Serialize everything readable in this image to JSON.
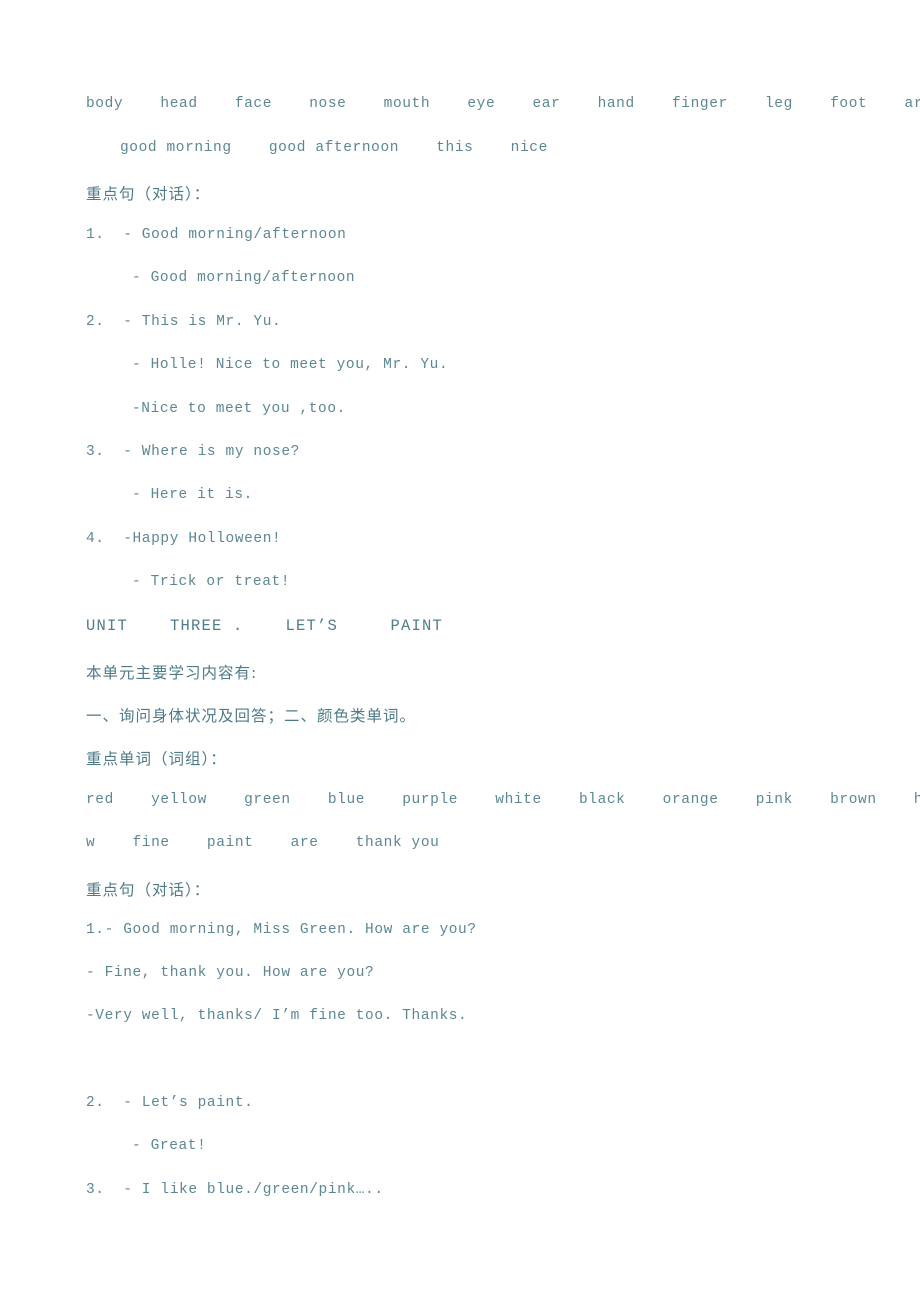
{
  "document": {
    "language": "zh-CN + en",
    "text_color": "#55808c",
    "background_color": "#ffffff",
    "unit_two_tail": {
      "vocabulary_line_1": "body    head    face    nose    mouth    eye    ear    hand    finger    leg    foot    arm",
      "vocabulary_line_2": "good morning    good afternoon    this    nice",
      "vocabulary_words_1": [
        "body",
        "head",
        "face",
        "nose",
        "mouth",
        "eye",
        "ear",
        "hand",
        "finger",
        "leg",
        "foot",
        "arm"
      ],
      "vocabulary_words_2": [
        "good morning",
        "good afternoon",
        "this",
        "nice"
      ],
      "key_sentences_heading": "重点句（对话）：",
      "dialogues": [
        {
          "number": "1.",
          "lines": [
            "1.  - Good morning/afternoon",
            "- Good morning/afternoon"
          ]
        },
        {
          "number": "2.",
          "lines": [
            "2.  - This is Mr. Yu.",
            "- Holle! Nice to meet you, Mr. Yu.",
            "-Nice to meet you ,too."
          ]
        },
        {
          "number": "3.",
          "lines": [
            "3.  - Where is my nose?",
            "- Here it is."
          ]
        },
        {
          "number": "4.",
          "lines": [
            "4.  -Happy Holloween!",
            "- Trick or treat!"
          ]
        }
      ]
    },
    "unit_three": {
      "title": "UNIT    THREE .    LET’S     PAINT",
      "overview_heading": "本单元主要学习内容有:",
      "overview_content": "一、询问身体状况及回答；二、颜色类单词。",
      "vocabulary_heading": "重点单词（词组）：",
      "vocabulary_line_1": "red    yellow    green    blue    purple    white    black    orange    pink    brown    ho",
      "vocabulary_line_2": "w    fine    paint    are    thank you",
      "vocabulary_words": [
        "red",
        "yellow",
        "green",
        "blue",
        "purple",
        "white",
        "black",
        "orange",
        "pink",
        "brown",
        "how",
        "fine",
        "paint",
        "are",
        "thank you"
      ],
      "key_sentences_heading": "重点句（对话）：",
      "dialogues": [
        {
          "number": "1.",
          "lines": [
            "1.- Good morning, Miss Green. How are you?",
            "- Fine, thank you. How are you?",
            "-Very well, thanks/ I’m fine too. Thanks."
          ]
        },
        {
          "number": "2.",
          "lines": [
            "2.  - Let’s paint.",
            "- Great!"
          ]
        },
        {
          "number": "3.",
          "lines": [
            "3.  - I like blue./green/pink….."
          ]
        }
      ]
    }
  }
}
